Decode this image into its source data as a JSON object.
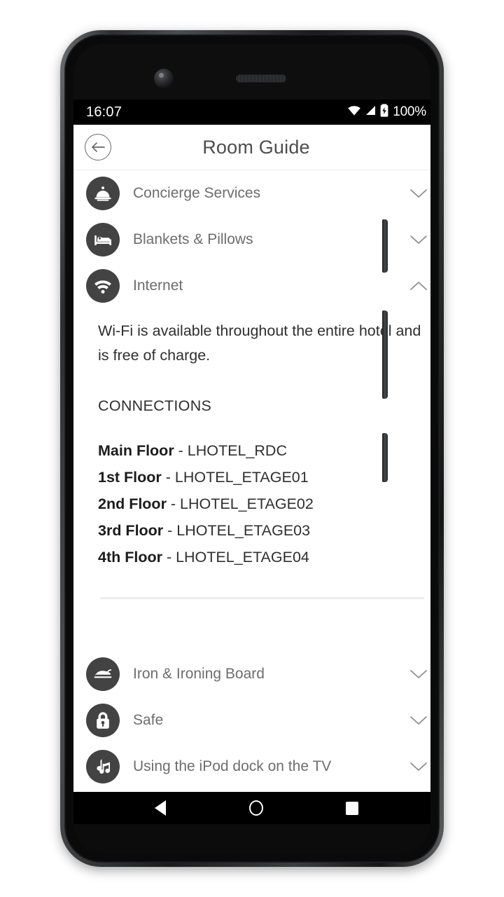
{
  "status_bar": {
    "time": "16:07",
    "battery_percent": "100%",
    "icons": [
      "wifi-icon",
      "cellular-signal-icon",
      "battery-charging-icon"
    ]
  },
  "header": {
    "title": "Room Guide",
    "back_icon": "back-arrow-circle-icon"
  },
  "accordion_items": [
    {
      "label": "Concierge Services",
      "icon": "service-bell-icon",
      "expanded": false,
      "chevron": "chevron-down-icon"
    },
    {
      "label": "Blankets & Pillows",
      "icon": "bed-icon",
      "expanded": false,
      "chevron": "chevron-down-icon"
    },
    {
      "label": "Internet",
      "icon": "wifi-icon",
      "expanded": true,
      "chevron": "chevron-up-icon"
    },
    {
      "label": "Iron & Ironing Board",
      "icon": "iron-icon",
      "expanded": false,
      "chevron": "chevron-down-icon"
    },
    {
      "label": "Safe",
      "icon": "padlock-icon",
      "expanded": false,
      "chevron": "chevron-down-icon"
    },
    {
      "label": "Using the iPod dock on the TV",
      "icon": "music-notes-icon",
      "expanded": false,
      "chevron": "chevron-down-icon"
    }
  ],
  "internet_panel": {
    "paragraph": "Wi-Fi is available throughout the entire hotel and is free of charge.",
    "connections_heading": "CONNECTIONS",
    "connections": [
      {
        "floor": "Main Floor",
        "separator": " - ",
        "ssid": "LHOTEL_RDC"
      },
      {
        "floor": "1st Floor",
        "separator": " - ",
        "ssid": "LHOTEL_ETAGE01"
      },
      {
        "floor": "2nd Floor",
        "separator": " - ",
        "ssid": "LHOTEL_ETAGE02"
      },
      {
        "floor": "3rd Floor",
        "separator": " - ",
        "ssid": "LHOTEL_ETAGE03"
      },
      {
        "floor": "4th Floor",
        "separator": " - ",
        "ssid": "LHOTEL_ETAGE04"
      }
    ]
  },
  "nav_bar": {
    "back": "nav-back-icon",
    "home": "nav-home-icon",
    "recents": "nav-recents-icon"
  },
  "colors": {
    "icon_circle": "#434343",
    "label_text": "#6d6d6d",
    "body_text": "#2f2f2f",
    "title_text": "#4d4d4d",
    "divider": "#ededed",
    "screen_bg": "#ffffff",
    "system_bar": "#000000"
  }
}
